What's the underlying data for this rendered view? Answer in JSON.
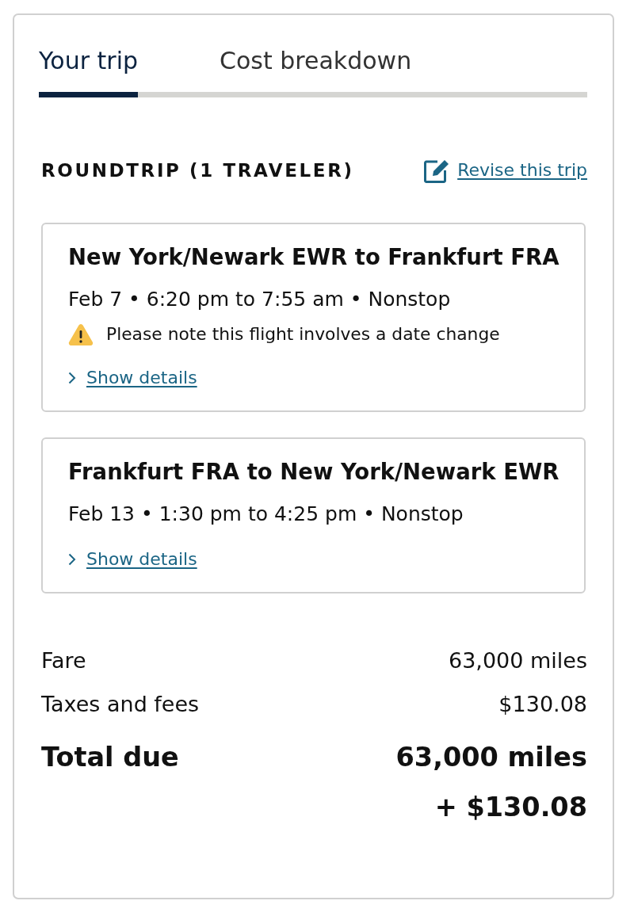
{
  "tabs": [
    {
      "label": "Your trip",
      "selected": true
    },
    {
      "label": "Cost breakdown",
      "selected": false
    }
  ],
  "trip": {
    "heading": "ROUNDTRIP (1 TRAVELER)",
    "revise_link": "Revise this trip"
  },
  "flights": [
    {
      "route": "New York/Newark EWR to Frankfurt FRA",
      "schedule": "Feb 7 • 6:20 pm to 7:55 am • Nonstop",
      "warning": "Please note this flight involves a date change",
      "details_link": "Show details"
    },
    {
      "route": "Frankfurt FRA to New York/Newark EWR",
      "schedule": "Feb 13 • 1:30 pm to 4:25 pm • Nonstop",
      "details_link": "Show details"
    }
  ],
  "costs": [
    {
      "label": "Fare",
      "value": "63,000 miles"
    },
    {
      "label": "Taxes and fees",
      "value": "$130.08"
    }
  ],
  "total": {
    "label": "Total due",
    "miles": "63,000 miles",
    "cash": "+ $130.08"
  }
}
